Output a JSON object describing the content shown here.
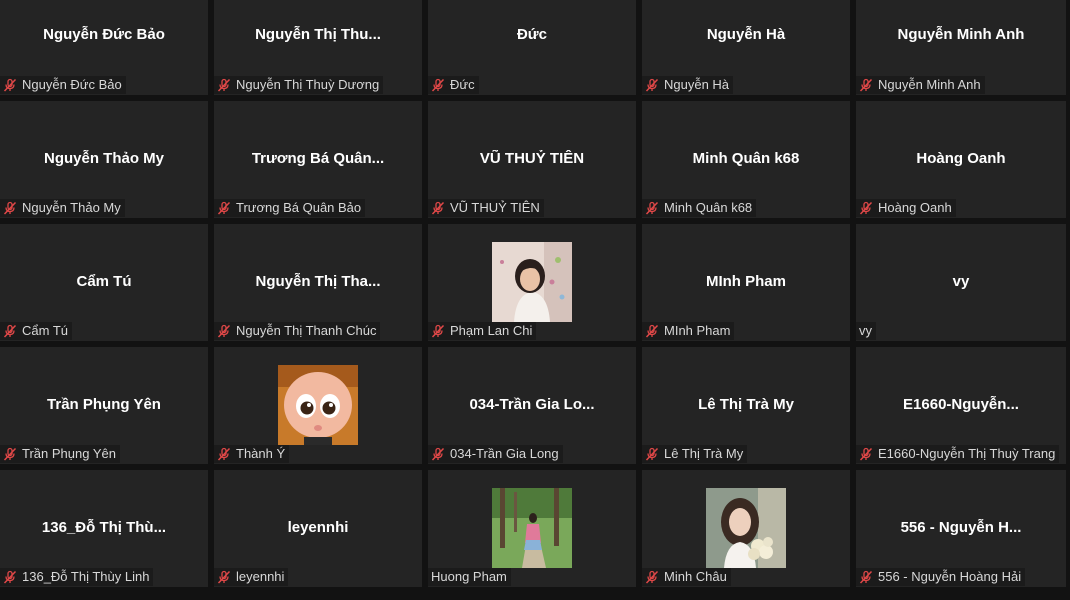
{
  "colors": {
    "background": "#121212",
    "tile": "#242424",
    "mute_icon": "#e04848",
    "name_text": "#ffffff",
    "label_text": "#d8d8d8"
  },
  "participants": [
    {
      "display": "Nguyễn Đức Bảo",
      "label": "Nguyễn Đức Bảo",
      "muted": true
    },
    {
      "display": "Nguyễn Thị Thu...",
      "label": "Nguyễn Thị Thuỳ Dương",
      "muted": true
    },
    {
      "display": "Đức",
      "label": "Đức",
      "muted": true
    },
    {
      "display": "Nguyễn Hà",
      "label": "Nguyễn Hà",
      "muted": true
    },
    {
      "display": "Nguyễn Minh Anh",
      "label": "Nguyễn Minh Anh",
      "muted": true
    },
    {
      "display": "Nguyễn Thảo My",
      "label": "Nguyễn Thảo My",
      "muted": true
    },
    {
      "display": "Trương Bá Quân...",
      "label": "Trương Bá Quân Bảo",
      "muted": true
    },
    {
      "display": "VŨ THUỶ TIÊN",
      "label": "VŨ THUỶ TIÊN",
      "muted": true
    },
    {
      "display": "Minh Quân k68",
      "label": "Minh Quân k68",
      "muted": true
    },
    {
      "display": "Hoàng Oanh",
      "label": "Hoàng Oanh",
      "muted": true
    },
    {
      "display": "Cẩm Tú",
      "label": "Cẩm Tú",
      "muted": true
    },
    {
      "display": "Nguyễn Thị Tha...",
      "label": "Nguyễn Thị Thanh Chúc",
      "muted": true
    },
    {
      "display": "",
      "label": "Phạm Lan Chi",
      "muted": true,
      "photo": "girl-portrait"
    },
    {
      "display": "MInh Pham",
      "label": "MInh Pham",
      "muted": true
    },
    {
      "display": "vy",
      "label": "vy",
      "muted": false
    },
    {
      "display": "Trần Phụng Yên",
      "label": "Trần Phụng Yên",
      "muted": true
    },
    {
      "display": "",
      "label": "Thành Ý",
      "muted": true,
      "photo": "baby-cartoon"
    },
    {
      "display": "034-Trần Gia Lo...",
      "label": "034-Trần Gia Long",
      "muted": true
    },
    {
      "display": "Lê Thị Trà My",
      "label": "Lê Thị Trà My",
      "muted": true
    },
    {
      "display": "E1660-Nguyễn...",
      "label": "E1660-Nguyễn Thị Thuỳ Trang",
      "muted": true
    },
    {
      "display": "136_Đỗ Thị Thù...",
      "label": "136_Đỗ Thị Thùy Linh",
      "muted": true
    },
    {
      "display": "leyennhi",
      "label": "leyennhi",
      "muted": true
    },
    {
      "display": "",
      "label": "Huong Pham",
      "muted": false,
      "photo": "park-photo"
    },
    {
      "display": "",
      "label": "Minh Châu",
      "muted": true,
      "photo": "flowers-portrait"
    },
    {
      "display": "556 - Nguyễn H...",
      "label": "556 - Nguyễn Hoàng Hải",
      "muted": true
    }
  ]
}
